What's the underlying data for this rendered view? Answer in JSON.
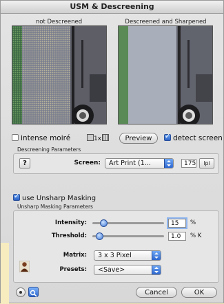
{
  "window": {
    "title": "USM & Descreening"
  },
  "preview": {
    "left_label": "not Descreened",
    "right_label": "Descreened and Sharpened"
  },
  "options": {
    "intense_moire": {
      "label": "intense moiré",
      "checked": false
    },
    "zoom_label": "1x",
    "preview_button": "Preview",
    "detect_screen": {
      "label": "detect screen",
      "checked": true
    }
  },
  "descreening": {
    "group_title": "Descreening Parameters",
    "help_button": "?",
    "screen_label": "Screen:",
    "screen_value": "Art Print (1...",
    "lpi_value": "175",
    "lpi_unit": "lpi"
  },
  "usm": {
    "checkbox_label": "use Unsharp Masking",
    "checked": true,
    "group_title": "Unsharp Masking Parameters",
    "intensity": {
      "label": "Intensity:",
      "value": "15",
      "unit": "%",
      "slider_fraction": 0.15
    },
    "threshold": {
      "label": "Threshold:",
      "value": "1.0",
      "unit": "% K",
      "slider_fraction": 0.1
    },
    "matrix": {
      "label": "Matrix:",
      "value": "3 x 3 Pixel"
    },
    "presets": {
      "label": "Presets:",
      "value": "<Save>"
    }
  },
  "footer": {
    "cancel_button": "Cancel",
    "ok_button": "OK"
  },
  "colors": {
    "accent_blue": "#3c78d6",
    "window_bg": "#dcdcdc",
    "page_bg": "#f3e6b8"
  }
}
